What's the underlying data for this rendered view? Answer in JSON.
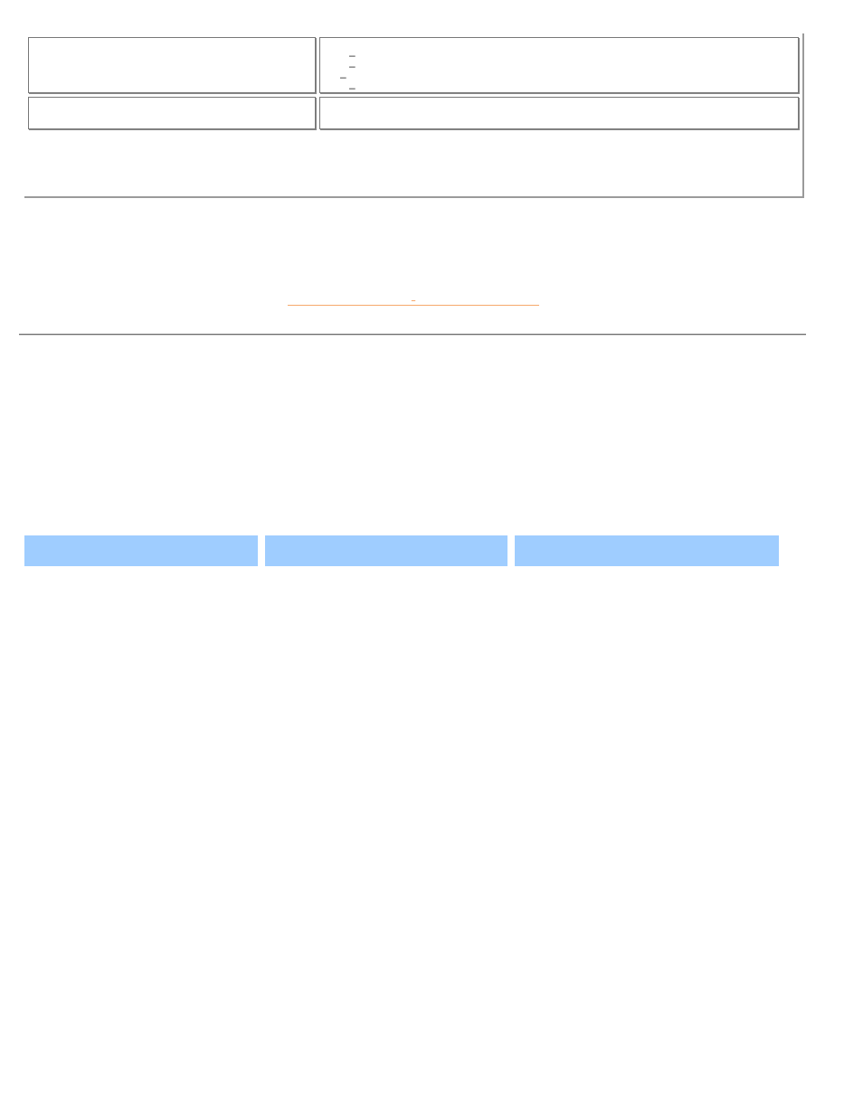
{
  "top_table": {
    "rows": [
      {
        "colA": "",
        "bullets": [
          {
            "indent": 1,
            "text": ""
          },
          {
            "indent": 1,
            "text": ""
          },
          {
            "indent": 2,
            "text": ""
          },
          {
            "indent": 1,
            "text": ""
          }
        ]
      },
      {
        "colA": "",
        "colB": ""
      }
    ]
  },
  "section_link": {
    "label": ""
  },
  "header_row": {
    "cells": [
      "",
      "",
      ""
    ]
  },
  "colors": {
    "accent_link": "#f6a96b",
    "header_bg": "#9fcdff",
    "rule": "#6b6b6b"
  }
}
